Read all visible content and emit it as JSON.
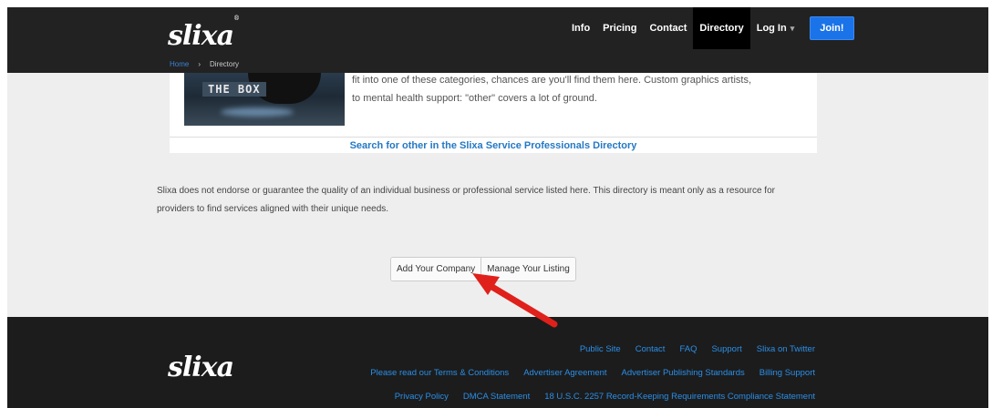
{
  "header": {
    "logo": "slixa",
    "nav": [
      "Info",
      "Pricing",
      "Contact",
      "Directory"
    ],
    "login_label": "Log In",
    "join_label": "Join!",
    "breadcrumb": {
      "home": "Home",
      "separator": "›",
      "current": "Directory"
    }
  },
  "category": {
    "thumb_text": "THE BOX",
    "description_line1": "fit into one of these categories, chances are you'll find them here. Custom graphics artists,",
    "description_line2": "to mental health support: \"other\" covers a lot of ground.",
    "search_link": "Search for other in the Slixa Service Professionals Directory"
  },
  "disclaimer": "Slixa does not endorse or guarantee the quality of an individual business or professional service listed here. This directory is meant only as a resource for providers to find services aligned with their unique needs.",
  "actions": {
    "add_company": "Add Your Company",
    "manage_listing": "Manage Your Listing"
  },
  "annotation": {
    "arrow_color": "#e0201b"
  },
  "footer": {
    "logo": "slixa",
    "row1": [
      "Public Site",
      "Contact",
      "FAQ",
      "Support",
      "Slixa on Twitter"
    ],
    "row2": [
      "Please read our Terms & Conditions",
      "Advertiser Agreement",
      "Advertiser Publishing Standards",
      "Billing Support"
    ],
    "row3": [
      "Privacy Policy",
      "DMCA Statement",
      "18 U.S.C. 2257 Record-Keeping Requirements Compliance Statement"
    ]
  },
  "colors": {
    "header_bg": "#222222",
    "footer_bg": "#1c1c1c",
    "link": "#2479c4",
    "join": "#1a73e8",
    "page_bg": "#eeeeee"
  }
}
